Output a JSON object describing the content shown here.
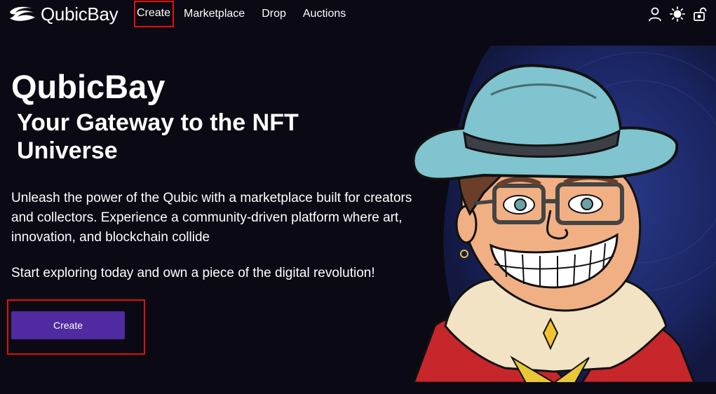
{
  "nav": {
    "brand": "QubicBay",
    "links": [
      {
        "label": "Create"
      },
      {
        "label": "Marketplace"
      },
      {
        "label": "Drop"
      },
      {
        "label": "Auctions"
      }
    ],
    "icons": [
      "user-icon",
      "sun-icon",
      "unlock-icon"
    ]
  },
  "hero": {
    "title": "QubicBay",
    "subtitle": "Your Gateway to the NFT Universe",
    "description": "Unleash the power of the Qubic with a marketplace built for creators and collectors. Experience a community-driven platform where art, innovation, and blockchain collide",
    "cta_text": "Start exploring today and own a piece of the digital revolution!",
    "cta_button": "Create",
    "image": "cowboy-character-illustration"
  },
  "colors": {
    "background": "#0b0913",
    "button": "#4f2aa0",
    "highlight": "#e01010",
    "text": "#ffffff"
  }
}
